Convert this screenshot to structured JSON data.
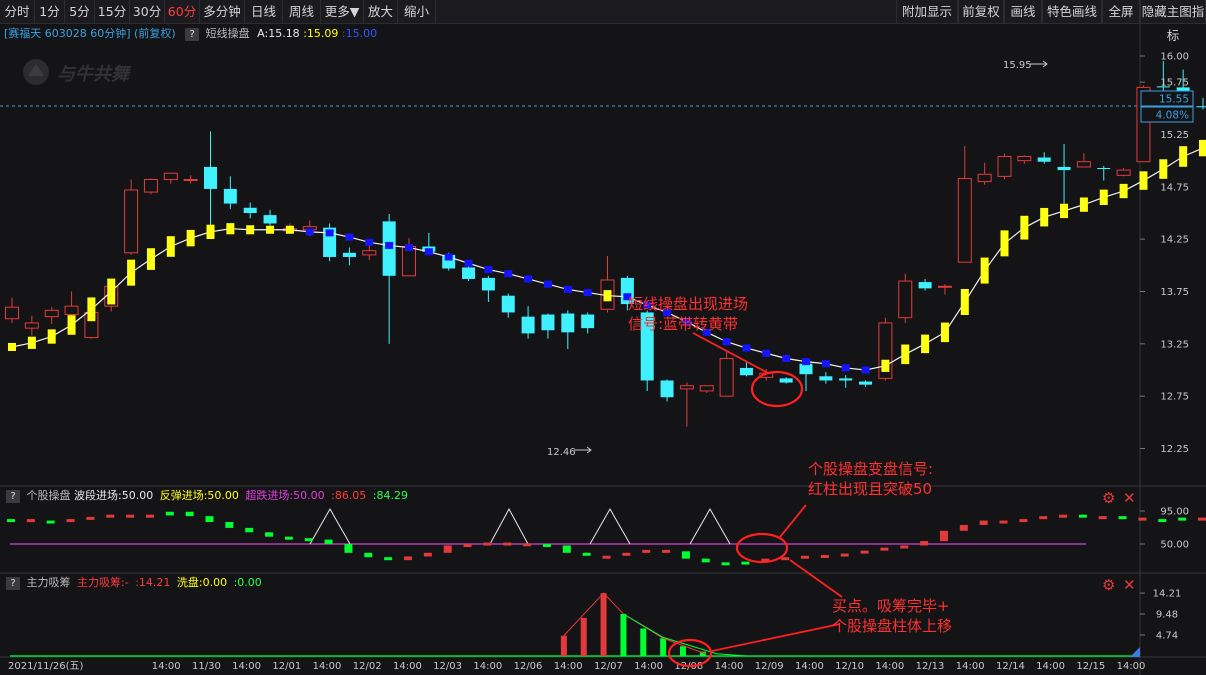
{
  "toolbar": {
    "left": [
      {
        "label": "分时"
      },
      {
        "label": "1分"
      },
      {
        "label": "5分"
      },
      {
        "label": "15分"
      },
      {
        "label": "30分"
      },
      {
        "label": "60分",
        "active": true
      },
      {
        "label": "多分钟"
      },
      {
        "label": "日线"
      },
      {
        "label": "周线"
      },
      {
        "label": "更多▼"
      },
      {
        "label": "放大"
      },
      {
        "label": "缩小"
      }
    ],
    "right": [
      {
        "label": "附加显示"
      },
      {
        "label": "前复权"
      },
      {
        "label": "画线"
      },
      {
        "label": "特色画线"
      },
      {
        "label": "全屏"
      },
      {
        "label": "隐藏主图指标"
      }
    ]
  },
  "info": {
    "stock": "[赛福天 603028 60分钟] (前复权)",
    "q": "?",
    "indicator": "短线操盘",
    "a_text": "A:15.18",
    "v2": ":15.09",
    "v3": ":15.00"
  },
  "watermark": "与牛共舞",
  "colors": {
    "up": "#e23a3a",
    "down": "#3ff0ff",
    "blue": "#1414ff",
    "yellow": "#ffff14",
    "green": "#00ff30",
    "magenta": "#d040d0",
    "white": "#ffffff"
  },
  "price_axis": [
    "16.00",
    "15.75",
    "15.25",
    "14.75",
    "14.25",
    "13.75",
    "13.25",
    "12.75",
    "12.25"
  ],
  "current_price": "15.55",
  "current_pct": "4.08%",
  "high_label": "15.95",
  "low_label": "12.46",
  "chart_data": {
    "type": "candlestick",
    "candles": [
      {
        "o": 13.49,
        "c": 13.6,
        "h": 13.69,
        "l": 13.45,
        "b": 13.22,
        "bc": "yellow"
      },
      {
        "o": 13.4,
        "c": 13.45,
        "h": 13.52,
        "l": 13.33,
        "b": 13.26,
        "bc": "yellow"
      },
      {
        "o": 13.51,
        "c": 13.57,
        "h": 13.6,
        "l": 13.44,
        "b": 13.32,
        "bc": "yellow"
      },
      {
        "o": 13.53,
        "c": 13.61,
        "h": 13.75,
        "l": 13.5,
        "b": 13.43,
        "bc": "yellow"
      },
      {
        "o": 13.31,
        "c": 13.55,
        "h": 13.58,
        "l": 13.3,
        "b": 13.58,
        "bc": "yellow"
      },
      {
        "o": 13.61,
        "c": 13.8,
        "h": 13.82,
        "l": 13.56,
        "b": 13.75,
        "bc": "yellow"
      },
      {
        "o": 14.12,
        "c": 14.72,
        "h": 14.82,
        "l": 14.1,
        "b": 13.93,
        "bc": "yellow"
      },
      {
        "o": 14.7,
        "c": 14.82,
        "h": 14.83,
        "l": 14.68,
        "b": 14.06,
        "bc": "yellow"
      },
      {
        "o": 14.82,
        "c": 14.88,
        "h": 14.88,
        "l": 14.78,
        "b": 14.18,
        "bc": "yellow"
      },
      {
        "o": 14.82,
        "c": 14.82,
        "h": 14.86,
        "l": 14.78,
        "b": 14.26,
        "bc": "yellow"
      },
      {
        "o": 14.94,
        "c": 14.73,
        "h": 15.28,
        "l": 14.26,
        "b": 14.32,
        "bc": "yellow"
      },
      {
        "o": 14.73,
        "c": 14.59,
        "h": 14.85,
        "l": 14.54,
        "b": 14.35,
        "bc": "yellow"
      },
      {
        "o": 14.55,
        "c": 14.5,
        "h": 14.6,
        "l": 14.45,
        "b": 14.34,
        "bc": "yellow"
      },
      {
        "o": 14.48,
        "c": 14.4,
        "h": 14.53,
        "l": 14.38,
        "b": 14.34,
        "bc": "yellow"
      },
      {
        "o": 14.33,
        "c": 14.35,
        "h": 14.4,
        "l": 14.3,
        "b": 14.34,
        "bc": "yellow"
      },
      {
        "o": 14.34,
        "c": 14.37,
        "h": 14.43,
        "l": 14.28,
        "b": 14.32,
        "bc": "blue"
      },
      {
        "o": 14.36,
        "c": 14.08,
        "h": 14.4,
        "l": 14.04,
        "b": 14.31,
        "bc": "blue"
      },
      {
        "o": 14.12,
        "c": 14.08,
        "h": 14.17,
        "l": 14.0,
        "b": 14.27,
        "bc": "blue"
      },
      {
        "o": 14.1,
        "c": 14.14,
        "h": 14.21,
        "l": 14.05,
        "b": 14.22,
        "bc": "blue"
      },
      {
        "o": 14.42,
        "c": 13.9,
        "h": 14.49,
        "l": 13.25,
        "b": 14.19,
        "bc": "blue"
      },
      {
        "o": 13.9,
        "c": 14.18,
        "h": 14.26,
        "l": 13.9,
        "b": 14.17,
        "bc": "blue"
      },
      {
        "o": 14.18,
        "c": 14.13,
        "h": 14.31,
        "l": 14.1,
        "b": 14.13,
        "bc": "blue"
      },
      {
        "o": 14.1,
        "c": 13.97,
        "h": 14.12,
        "l": 13.95,
        "b": 14.08,
        "bc": "blue"
      },
      {
        "o": 13.98,
        "c": 13.87,
        "h": 14.03,
        "l": 13.85,
        "b": 14.02,
        "bc": "blue"
      },
      {
        "o": 13.88,
        "c": 13.76,
        "h": 13.9,
        "l": 13.65,
        "b": 13.96,
        "bc": "blue"
      },
      {
        "o": 13.71,
        "c": 13.55,
        "h": 13.73,
        "l": 13.5,
        "b": 13.92,
        "bc": "blue"
      },
      {
        "o": 13.51,
        "c": 13.35,
        "h": 13.61,
        "l": 13.3,
        "b": 13.87,
        "bc": "blue"
      },
      {
        "o": 13.53,
        "c": 13.38,
        "h": 13.54,
        "l": 13.3,
        "b": 13.82,
        "bc": "blue"
      },
      {
        "o": 13.54,
        "c": 13.36,
        "h": 13.57,
        "l": 13.2,
        "b": 13.77,
        "bc": "blue"
      },
      {
        "o": 13.53,
        "c": 13.4,
        "h": 13.55,
        "l": 13.35,
        "b": 13.74,
        "bc": "blue"
      },
      {
        "o": 13.58,
        "c": 13.86,
        "h": 14.09,
        "l": 13.55,
        "b": 13.71,
        "bc": "yellow"
      },
      {
        "o": 13.88,
        "c": 13.63,
        "h": 13.9,
        "l": 13.57,
        "b": 13.7,
        "bc": "blue"
      },
      {
        "o": 13.55,
        "c": 12.9,
        "h": 13.57,
        "l": 12.8,
        "b": 13.62,
        "bc": "blue"
      },
      {
        "o": 12.9,
        "c": 12.74,
        "h": 12.91,
        "l": 12.7,
        "b": 13.55,
        "bc": "blue"
      },
      {
        "o": 12.82,
        "c": 12.85,
        "h": 12.88,
        "l": 12.46,
        "b": 13.46,
        "bc": "blue"
      },
      {
        "o": 12.8,
        "c": 12.85,
        "h": 12.85,
        "l": 12.78,
        "b": 13.36,
        "bc": "blue"
      },
      {
        "o": 12.75,
        "c": 13.11,
        "h": 13.18,
        "l": 12.75,
        "b": 13.27,
        "bc": "blue"
      },
      {
        "o": 13.02,
        "c": 12.95,
        "h": 13.08,
        "l": 12.94,
        "b": 13.21,
        "bc": "blue"
      },
      {
        "o": 12.93,
        "c": 12.97,
        "h": 13.01,
        "l": 12.9,
        "b": 13.16,
        "bc": "blue"
      },
      {
        "o": 12.92,
        "c": 12.88,
        "h": 12.93,
        "l": 12.87,
        "b": 13.11,
        "bc": "blue"
      },
      {
        "o": 13.06,
        "c": 12.96,
        "h": 13.07,
        "l": 12.8,
        "b": 13.08,
        "bc": "blue"
      },
      {
        "o": 12.94,
        "c": 12.9,
        "h": 12.98,
        "l": 12.87,
        "b": 13.06,
        "bc": "blue"
      },
      {
        "o": 12.92,
        "c": 12.9,
        "h": 12.95,
        "l": 12.83,
        "b": 13.02,
        "bc": "blue"
      },
      {
        "o": 12.89,
        "c": 12.86,
        "h": 12.9,
        "l": 12.84,
        "b": 13.0,
        "bc": "blue"
      },
      {
        "o": 12.92,
        "c": 13.45,
        "h": 13.5,
        "l": 12.9,
        "b": 13.04,
        "bc": "yellow"
      },
      {
        "o": 13.5,
        "c": 13.85,
        "h": 13.92,
        "l": 13.45,
        "b": 13.15,
        "bc": "yellow"
      },
      {
        "o": 13.84,
        "c": 13.78,
        "h": 13.87,
        "l": 13.76,
        "b": 13.25,
        "bc": "yellow"
      },
      {
        "o": 13.8,
        "c": 13.8,
        "h": 13.82,
        "l": 13.72,
        "b": 13.36,
        "bc": "yellow"
      },
      {
        "o": 14.03,
        "c": 14.83,
        "h": 15.14,
        "l": 14.03,
        "b": 13.65,
        "bc": "yellow"
      },
      {
        "o": 14.8,
        "c": 14.87,
        "h": 14.98,
        "l": 14.77,
        "b": 13.95,
        "bc": "yellow"
      },
      {
        "o": 14.85,
        "c": 15.04,
        "h": 15.07,
        "l": 14.82,
        "b": 14.21,
        "bc": "yellow"
      },
      {
        "o": 15.0,
        "c": 15.04,
        "h": 15.05,
        "l": 14.97,
        "b": 14.36,
        "bc": "yellow"
      },
      {
        "o": 15.03,
        "c": 14.99,
        "h": 15.08,
        "l": 14.97,
        "b": 14.46,
        "bc": "yellow"
      },
      {
        "o": 14.94,
        "c": 14.91,
        "h": 15.16,
        "l": 14.54,
        "b": 14.52,
        "bc": "yellow"
      },
      {
        "o": 14.94,
        "c": 14.99,
        "h": 15.07,
        "l": 14.94,
        "b": 14.58,
        "bc": "yellow"
      },
      {
        "o": 14.93,
        "c": 14.92,
        "h": 14.95,
        "l": 14.81,
        "b": 14.65,
        "bc": "yellow"
      },
      {
        "o": 14.86,
        "c": 14.91,
        "h": 14.93,
        "l": 14.85,
        "b": 14.71,
        "bc": "yellow"
      },
      {
        "o": 14.99,
        "c": 15.7,
        "h": 15.72,
        "l": 14.99,
        "b": 14.81,
        "bc": "yellow"
      },
      {
        "o": 15.71,
        "c": 15.7,
        "h": 15.95,
        "l": 15.6,
        "b": 14.92,
        "bc": "yellow"
      },
      {
        "o": 15.7,
        "c": 15.47,
        "h": 15.87,
        "l": 15.47,
        "b": 15.04,
        "bc": "yellow"
      },
      {
        "o": 15.52,
        "c": 15.51,
        "h": 15.6,
        "l": 15.49,
        "b": 15.12,
        "bc": "yellow"
      }
    ],
    "date_labels": [
      "2021/11/26(五)",
      "14:00",
      "11/30",
      "14:00",
      "12/01",
      "14:00",
      "12/02",
      "14:00",
      "12/03",
      "14:00",
      "12/06",
      "14:00",
      "12/07",
      "14:00",
      "12/08",
      "14:00",
      "12/09",
      "14:00",
      "12/10",
      "14:00",
      "12/13",
      "14:00",
      "12/14",
      "14:00",
      "12/15",
      "14:00"
    ]
  },
  "sub1": {
    "q": "?",
    "name": "个股操盘",
    "p1": "波段进场:50.00",
    "p2": "反弹进场:50.00",
    "p3": "超跌进场:50.00",
    "p4": ":86.05",
    "p5": ":84.29",
    "axis": [
      "95.00",
      "50.00"
    ],
    "values": [
      84,
      82,
      82,
      84,
      87,
      90,
      90,
      89,
      94,
      88,
      80,
      72,
      66,
      60,
      58,
      56,
      50,
      38,
      32,
      28,
      33,
      38,
      48,
      50,
      52,
      51,
      50,
      48,
      38,
      34,
      34,
      38,
      42,
      40,
      30,
      25,
      24,
      26,
      30,
      32,
      34,
      35,
      37,
      41,
      45,
      48,
      54,
      68,
      76,
      82,
      82,
      84,
      88,
      90,
      88,
      88,
      86,
      84,
      84,
      86,
      86,
      84,
      80
    ],
    "colors": [
      "g",
      "r",
      "g",
      "r",
      "r",
      "r",
      "r",
      "r",
      "g",
      "g",
      "g",
      "g",
      "g",
      "g",
      "g",
      "g",
      "g",
      "g",
      "g",
      "g",
      "r",
      "r",
      "r",
      "r",
      "r",
      "r",
      "r",
      "g",
      "g",
      "g",
      "r",
      "r",
      "r",
      "r",
      "g",
      "g",
      "g",
      "g",
      "r",
      "r",
      "r",
      "r",
      "r",
      "r",
      "r",
      "r",
      "r",
      "r",
      "r",
      "r",
      "r",
      "r",
      "r",
      "r",
      "g",
      "r",
      "g",
      "r",
      "g",
      "g",
      "r",
      "r",
      "g"
    ]
  },
  "sub2": {
    "q": "?",
    "name": "主力吸筹",
    "p1": "主力吸筹:-",
    "p2": ":14.21",
    "p3": "洗盘:0.00",
    "p4": ":0.00",
    "axis": [
      "14.21",
      "9.48",
      "4.74"
    ]
  },
  "annotations": {
    "a1_line1": "短线操盘出现进场",
    "a1_line2": "信号:蓝带转黄带",
    "a2_line1": "个股操盘变盘信号:",
    "a2_line2": "红柱出现且突破50",
    "a3_line1": "买点。吸筹完毕+",
    "a3_line2": "个股操盘柱体上移"
  }
}
